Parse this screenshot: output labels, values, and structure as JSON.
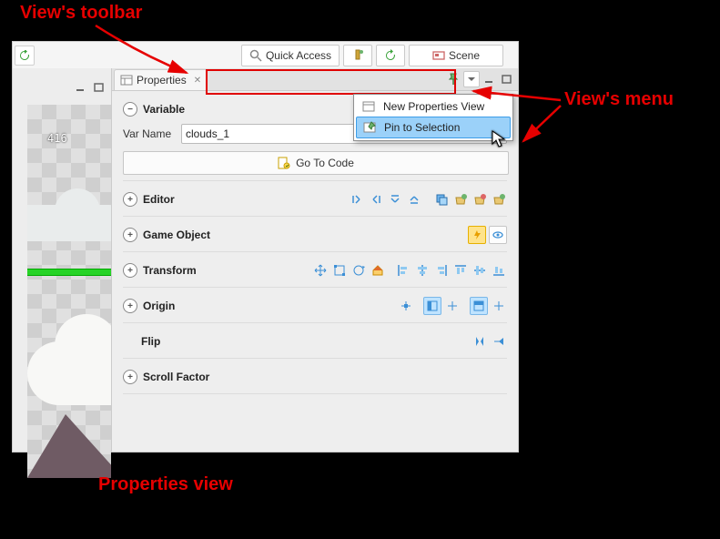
{
  "annotations": {
    "views_toolbar": "View's toolbar",
    "views_menu": "View's menu",
    "properties_view": "Properties view"
  },
  "top_toolbar": {
    "quick_access": "Quick Access",
    "scene": "Scene"
  },
  "canvas": {
    "coordinate": "416"
  },
  "tab": {
    "title": "Properties"
  },
  "view_menu": {
    "items": [
      {
        "label": "New Properties View"
      },
      {
        "label": "Pin to Selection"
      }
    ]
  },
  "sections": {
    "variable": {
      "title": "Variable",
      "var_name_label": "Var Name",
      "var_name_value": "clouds_1",
      "goto_code": "Go To Code"
    },
    "editor": {
      "title": "Editor"
    },
    "game_object": {
      "title": "Game Object"
    },
    "transform": {
      "title": "Transform"
    },
    "origin": {
      "title": "Origin"
    },
    "flip": {
      "title": "Flip"
    },
    "scroll_factor": {
      "title": "Scroll Factor"
    }
  }
}
